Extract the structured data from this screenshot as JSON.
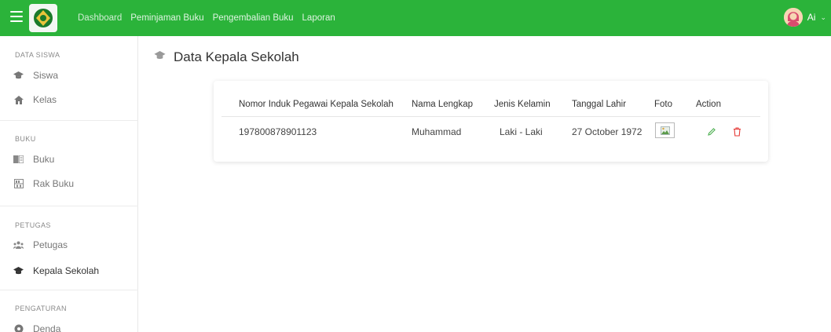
{
  "header": {
    "nav": [
      "Dashboard",
      "Peminjaman Buku",
      "Pengembalian Buku",
      "Laporan"
    ],
    "user_name": "Ai"
  },
  "sidebar": {
    "sections": [
      {
        "title": "DATA SISWA",
        "items": [
          {
            "label": "Siswa",
            "icon": "graduation-cap-icon"
          },
          {
            "label": "Kelas",
            "icon": "home-icon"
          }
        ]
      },
      {
        "title": "BUKU",
        "items": [
          {
            "label": "Buku",
            "icon": "book-icon"
          },
          {
            "label": "Rak Buku",
            "icon": "bookshelf-icon"
          }
        ]
      },
      {
        "title": "PETUGAS",
        "items": [
          {
            "label": "Petugas",
            "icon": "users-icon"
          },
          {
            "label": "Kepala Sekolah",
            "icon": "graduation-cap-icon"
          }
        ]
      },
      {
        "title": "PENGATURAN",
        "items": [
          {
            "label": "Denda",
            "icon": "settings-icon"
          }
        ]
      }
    ],
    "active_item": "Kepala Sekolah"
  },
  "page": {
    "title": "Data Kepala Sekolah"
  },
  "table": {
    "columns": [
      "Nomor Induk Pegawai Kepala Sekolah",
      "Nama Lengkap",
      "Jenis Kelamin",
      "Tanggal Lahir",
      "Foto",
      "Action"
    ],
    "rows": [
      {
        "nip": "197800878901123",
        "nama": "Muhammad",
        "jenis_kelamin": "Laki - Laki",
        "tanggal_lahir": "27 October 1972"
      }
    ]
  },
  "colors": {
    "header_bg": "#2bb33a",
    "edit": "#4caf50",
    "delete": "#e53935"
  }
}
